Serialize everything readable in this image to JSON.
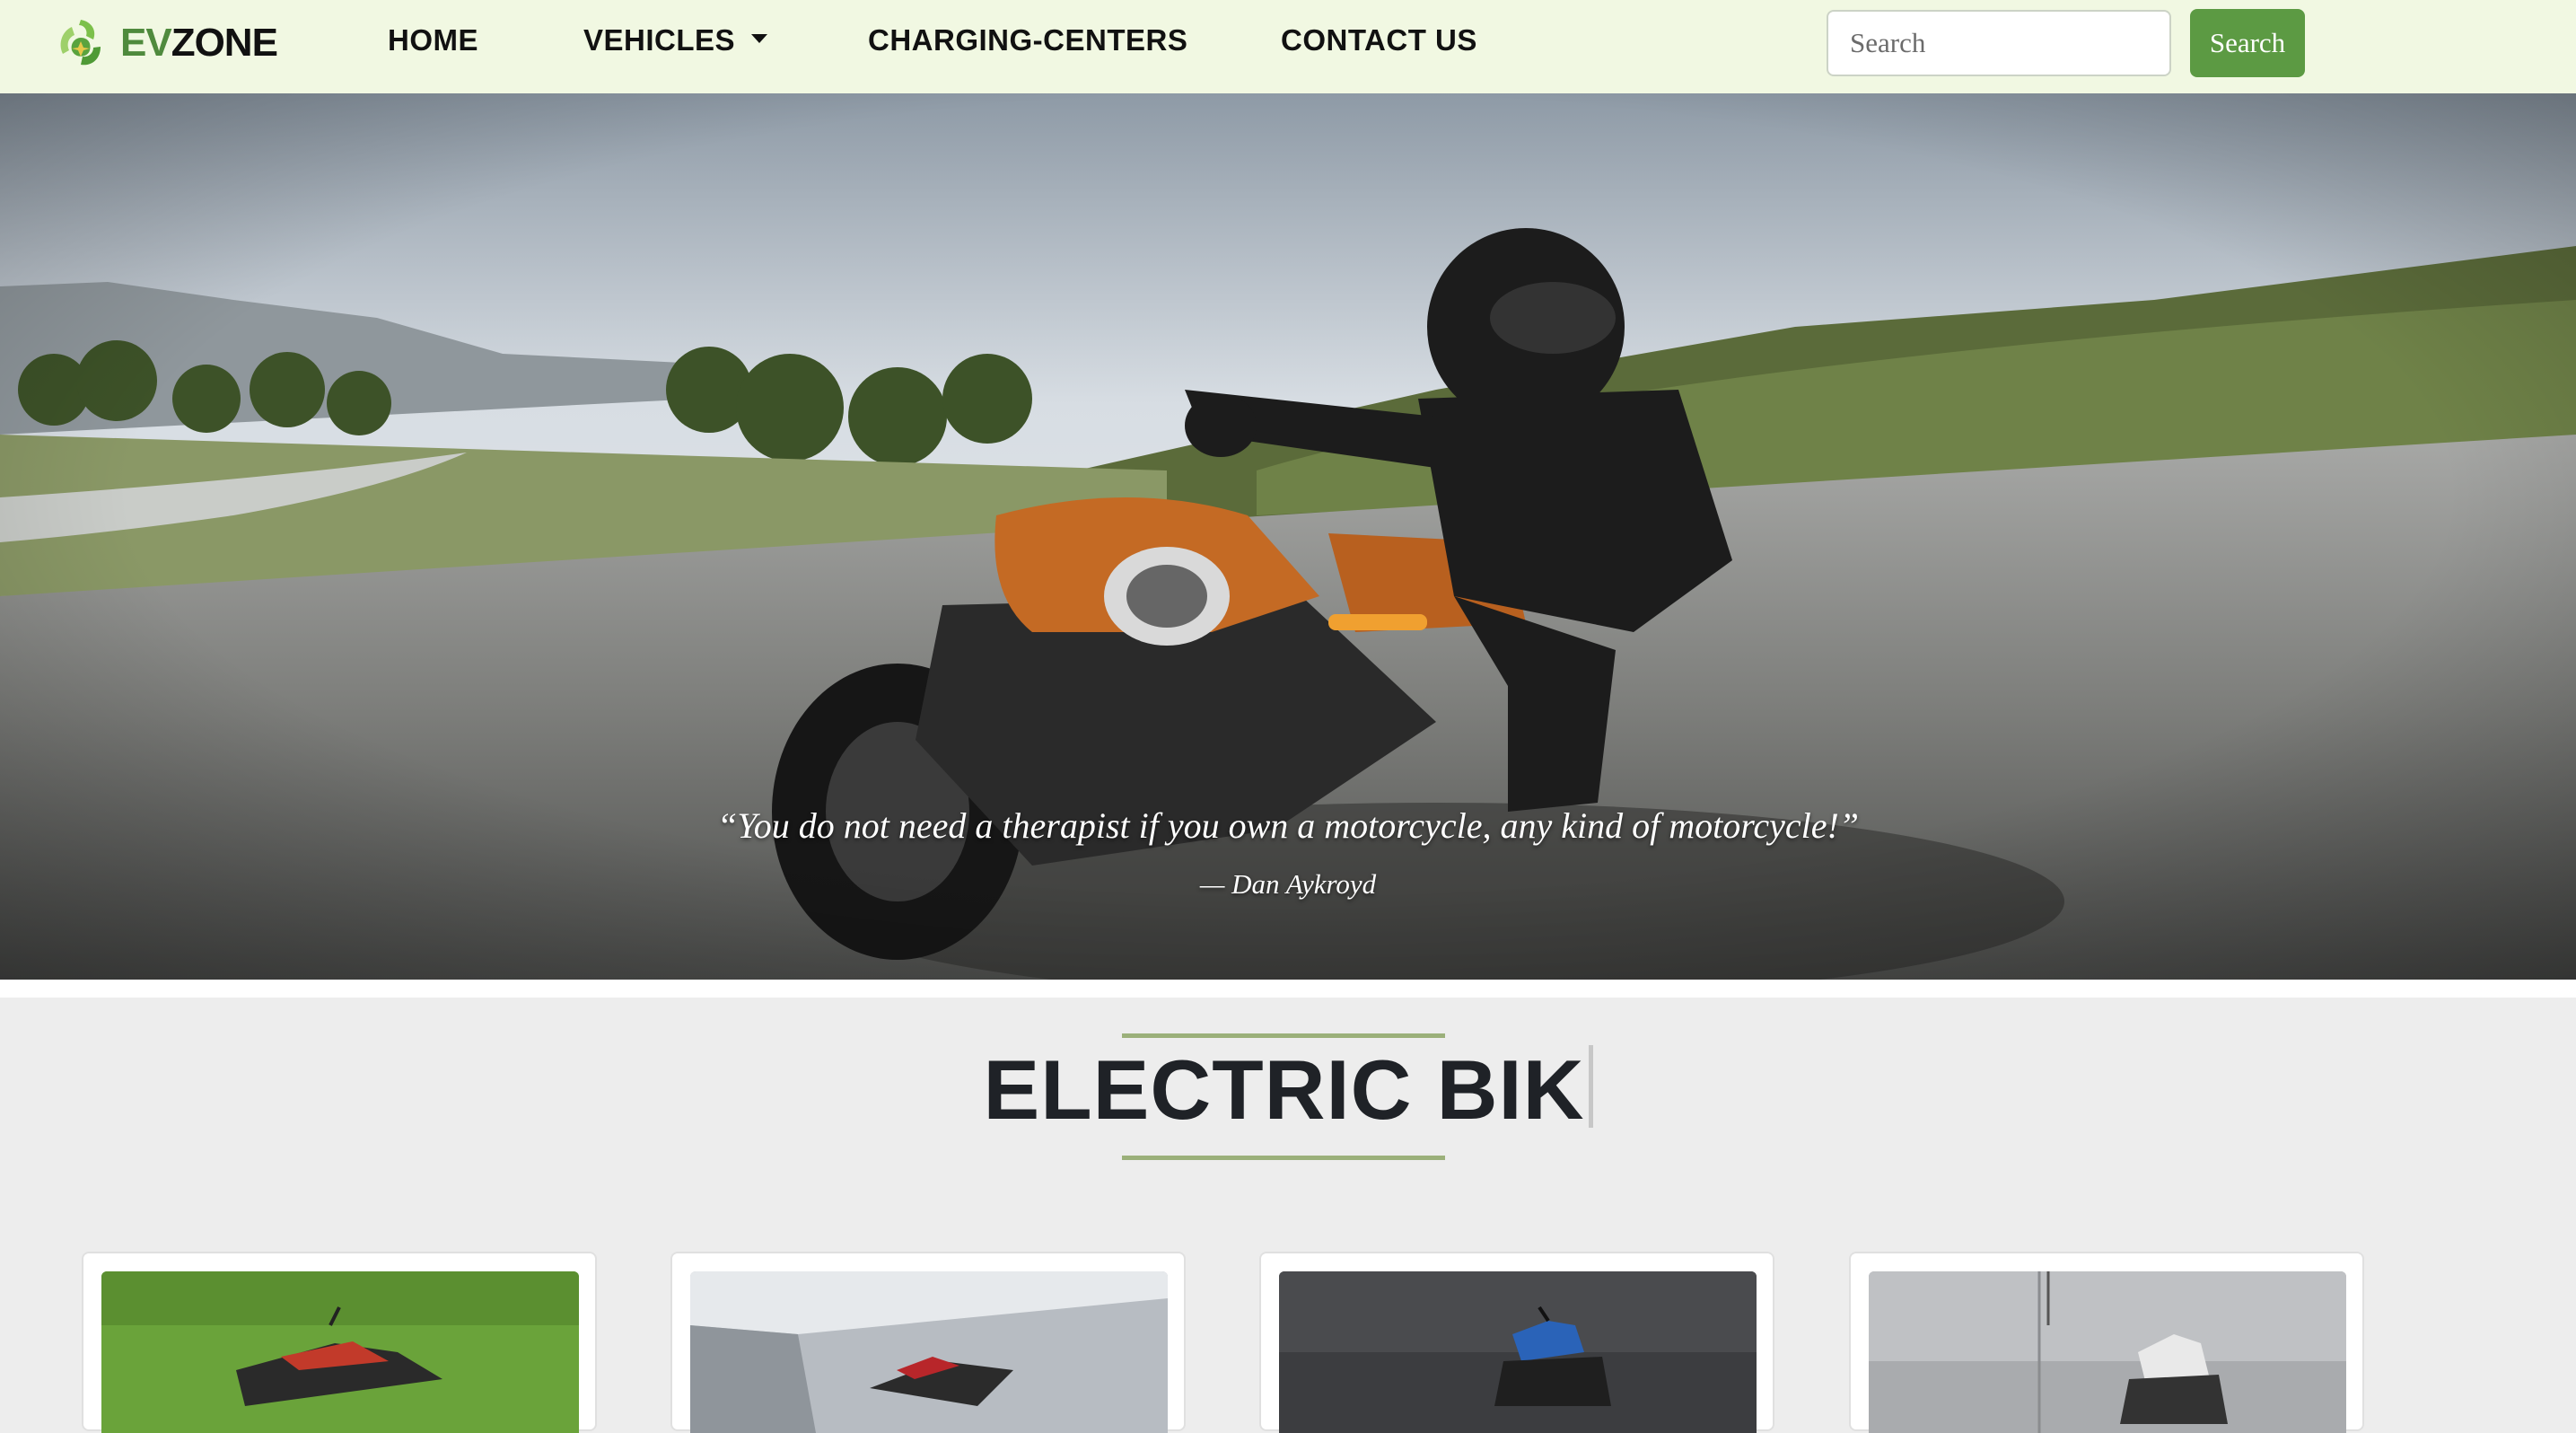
{
  "navbar": {
    "brand": {
      "ev": "EV",
      "zone": "ZONE",
      "logo_icon": "recycle-leaf-logo-icon"
    },
    "links": [
      {
        "label": "HOME"
      },
      {
        "label": "VEHICLES",
        "icon": "dropdown-caret-icon"
      },
      {
        "label": "CHARGING-CENTERS"
      },
      {
        "label": "CONTACT US"
      }
    ],
    "search": {
      "placeholder": "Search",
      "button_label": "Search"
    },
    "colors": {
      "background": "#f1f8e2",
      "accent": "#5c9a43"
    }
  },
  "hero": {
    "quote": "“You do not need a therapist if you own a motorcycle, any kind of motorcycle!”",
    "author": "— Dan Aykroyd"
  },
  "section": {
    "title": "ELECTRIC BIK",
    "rule_color": "#9bb07a",
    "cards": [
      {
        "image": "red-motorcycle-on-grass"
      },
      {
        "image": "red-motorcycle-under-concrete-canopy"
      },
      {
        "image": "blue-motorcycle-dark-wall"
      },
      {
        "image": "white-motorcycle-grey-wall"
      }
    ]
  }
}
